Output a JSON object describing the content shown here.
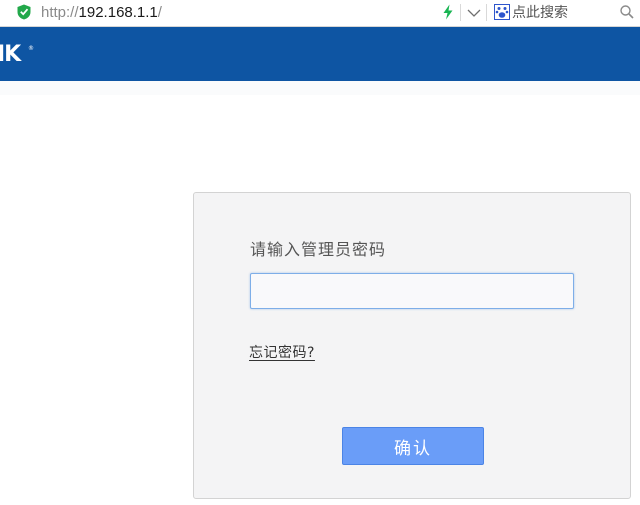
{
  "browser": {
    "url_protocol": "http://",
    "url_host": "192.168.1.1",
    "url_path": "/",
    "search_placeholder": "点此搜索",
    "icons": {
      "security": "shield-check-icon",
      "speed": "lightning-bolt-icon",
      "dropdown": "chevron-down-icon",
      "engine": "baidu-paw-icon",
      "search": "magnifier-icon"
    }
  },
  "header": {
    "logo_text": "IK",
    "logo_mark": "®",
    "bg_color": "#0e55a3"
  },
  "login": {
    "prompt": "请输入管理员密码",
    "password_value": "",
    "forgot_link": "忘记密码?",
    "confirm_label": "确认",
    "button_color": "#6a9df8"
  }
}
